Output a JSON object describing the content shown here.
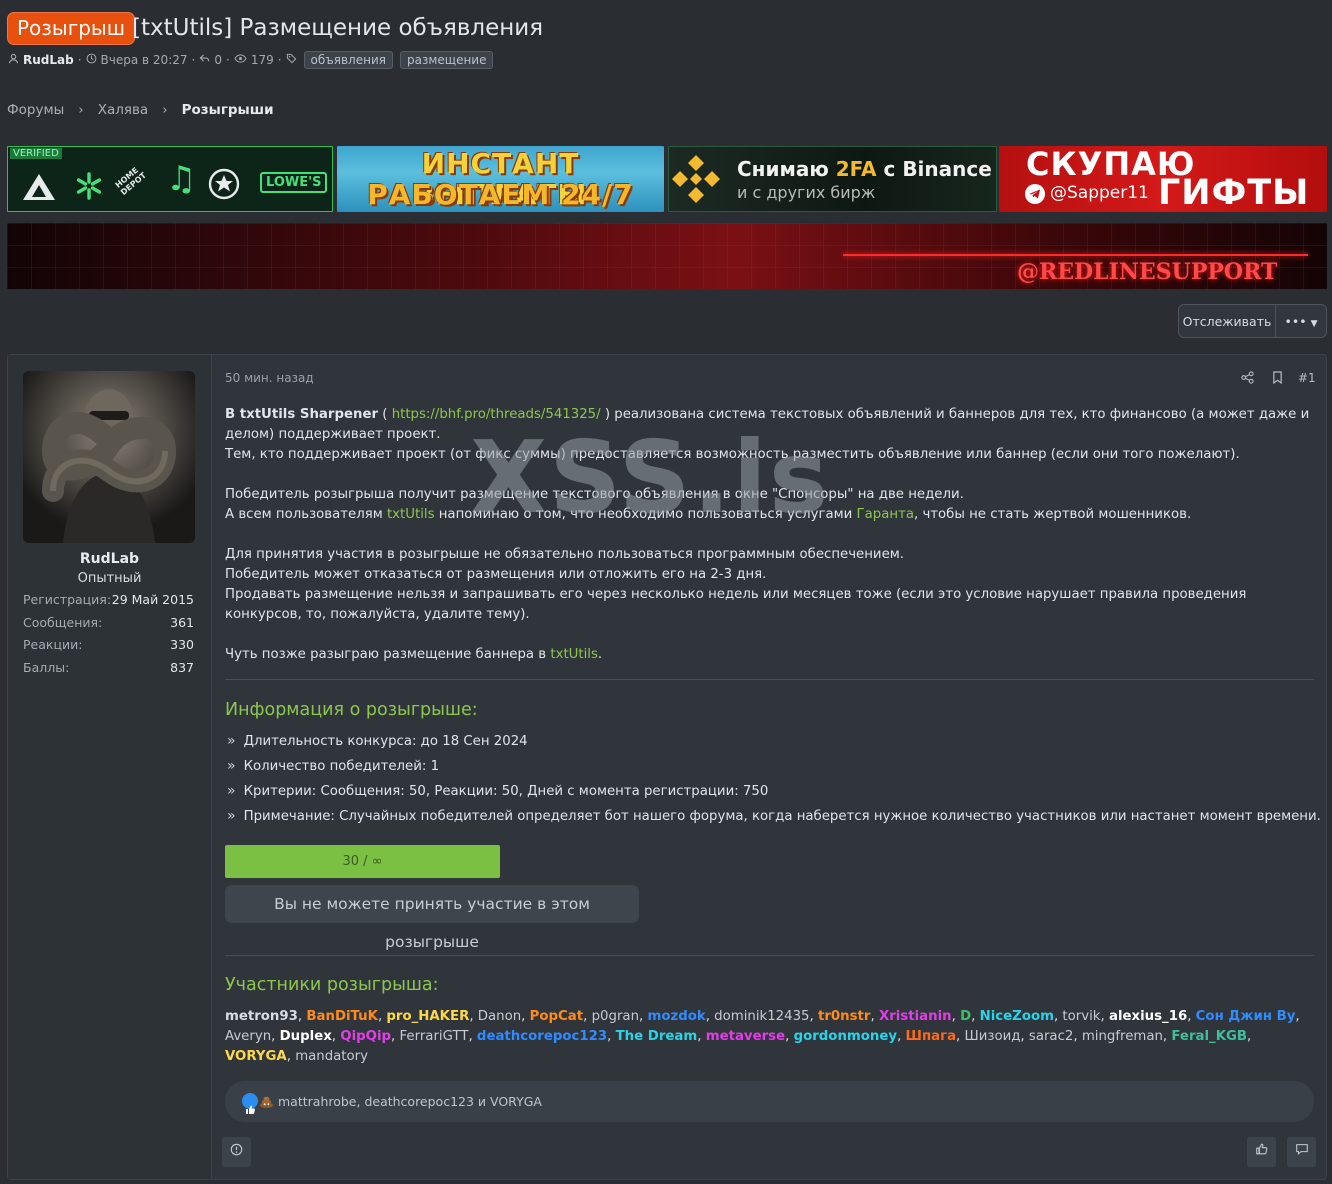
{
  "thread": {
    "prefix": "Розыгрыш",
    "title": "[txtUtils] Размещение объявления",
    "author": "RudLab",
    "date": "Вчера в 20:27",
    "replies": "0",
    "views": "179",
    "tags": [
      "объявления",
      "размещение"
    ]
  },
  "breadcrumbs": [
    "Форумы",
    "Халява",
    "Розыгрыши"
  ],
  "banners": {
    "b1_badge": "VERIFIED",
    "b1_logo": "LOWE'S",
    "b2_line1": "ИНСТАНТ ВЫПЛАТЫ",
    "b2_line2": "РАБОТАЕМ 24/7",
    "b3_pre": "Снимаю ",
    "b3_hl": "2FA",
    "b3_post": " с Binance",
    "b3_line2": "и с других бирж",
    "b4_line1": "СКУПАЮ",
    "b4_handle": "@Sapper11",
    "b4_line2": "ГИФТЫ",
    "wide_text": "@REDLINESUPPORT"
  },
  "actions": {
    "watch": "Отслеживать",
    "more": "•••"
  },
  "user": {
    "name": "RudLab",
    "title": "Опытный",
    "stats": [
      {
        "label": "Регистрация:",
        "value": "29 Май 2015"
      },
      {
        "label": "Сообщения:",
        "value": "361"
      },
      {
        "label": "Реакции:",
        "value": "330"
      },
      {
        "label": "Баллы:",
        "value": "837"
      }
    ]
  },
  "post": {
    "time": "50 мин. назад",
    "number": "#1",
    "p1_bold": "В txtUtils Sharpener",
    "p1_open": " ( ",
    "p1_link": "https://bhf.pro/threads/541325/",
    "p1_rest": " ) реализована система текстовых объявлений и баннеров для тех, кто финансово (а может даже и делом) поддерживает проект.",
    "p2": "Тем, кто поддерживает проект (от фикс суммы) предоставляется возможность разместить объявление или баннер (если они того пожелают).",
    "p3": "Победитель розыгрыша получит размещение текстового объявления в окне \"Спонсоры\" на две недели.",
    "p4_a": "А всем пользователям ",
    "p4_link1": "txtUtils",
    "p4_b": " напоминаю о том, что необходимо пользоваться услугами ",
    "p4_link2": "Гаранта",
    "p4_c": ", чтобы не стать жертвой мошенников.",
    "p5": "Для принятия участия в розыгрыше не обязательно пользоваться программным обеспечением.",
    "p6": "Победитель может отказаться от размещения или отложить его на 2-3 дня.",
    "p7": "Продавать размещение нельзя и запрашивать его через несколько недель или месяцев тоже (если это условие нарушает правила проведения конкурсов, то, пожалуйста, удалите тему).",
    "p8_a": "Чуть позже разыграю размещение баннера в ",
    "p8_link": "txtUtils",
    "p8_b": ".",
    "watermark": "XSS.is"
  },
  "giveaway": {
    "info_title": "Информация о розыгрыше:",
    "items": [
      "Длительность конкурса: до 18 Сен 2024",
      "Количество победителей: 1",
      "Критерии: Сообщения: 50, Реакции: 50, Дней с момента регистрации: 750",
      "Примечание: Случайных победителей определяет бот нашего форума, когда наберется нужное количество участников или настанет момент времени."
    ],
    "progress": "30 / ∞",
    "cannot_join": "Вы не можете принять участие в этом розыгрыше",
    "participants_title": "Участники розыгрыша:",
    "participants": [
      {
        "name": "metron93",
        "color": "#d9dde2"
      },
      {
        "name": "BanDiTuK",
        "color": "#ff8c1a"
      },
      {
        "name": "pro_HAKER",
        "color": "#ffd84a"
      },
      {
        "name": "Danon",
        "color": "#c6cbd0"
      },
      {
        "name": "PopCat",
        "color": "#ff8c1a"
      },
      {
        "name": "p0gran",
        "color": "#c6cbd0"
      },
      {
        "name": "mozdok",
        "color": "#2f8cff"
      },
      {
        "name": "dominik12435",
        "color": "#c6cbd0"
      },
      {
        "name": "tr0nstr",
        "color": "#ff8c1a"
      },
      {
        "name": "Xristianin",
        "color": "#e33de8"
      },
      {
        "name": "D",
        "color": "#3fbf6a"
      },
      {
        "name": "NiceZoom",
        "color": "#27d4e8"
      },
      {
        "name": "torvik",
        "color": "#c6cbd0"
      },
      {
        "name": "alexius_16",
        "color": "#ffffff"
      },
      {
        "name": "Сон Джин Ву",
        "color": "#2f8cff"
      },
      {
        "name": "Averyn",
        "color": "#c6cbd0"
      },
      {
        "name": "Duplex",
        "color": "#ffffff"
      },
      {
        "name": "QipQip",
        "color": "#e33de8"
      },
      {
        "name": "FerrariGTT",
        "color": "#c6cbd0"
      },
      {
        "name": "deathcorepoc123",
        "color": "#2f8cff"
      },
      {
        "name": "The Dream",
        "color": "#27d4e8"
      },
      {
        "name": "metaverse",
        "color": "#e33de8"
      },
      {
        "name": "gordonmoney",
        "color": "#27d4e8"
      },
      {
        "name": "Шпага",
        "color": "#ff6a1a"
      },
      {
        "name": "Шизоид",
        "color": "#c6cbd0"
      },
      {
        "name": "sarac2",
        "color": "#c6cbd0"
      },
      {
        "name": "mingfreman",
        "color": "#c6cbd0"
      },
      {
        "name": "Feral_KGB",
        "color": "#3fbf9a"
      },
      {
        "name": "VORYGA",
        "color": "#ffd84a"
      },
      {
        "name": "mandatory",
        "color": "#c6cbd0"
      }
    ]
  },
  "reactions": {
    "text": "mattrahrobe, deathcorepoc123 и VORYGA"
  },
  "colors": {
    "accent": "#8cc74d",
    "prefix": "#e8500d",
    "bg": "#2a2e33",
    "panel": "#30353b"
  }
}
